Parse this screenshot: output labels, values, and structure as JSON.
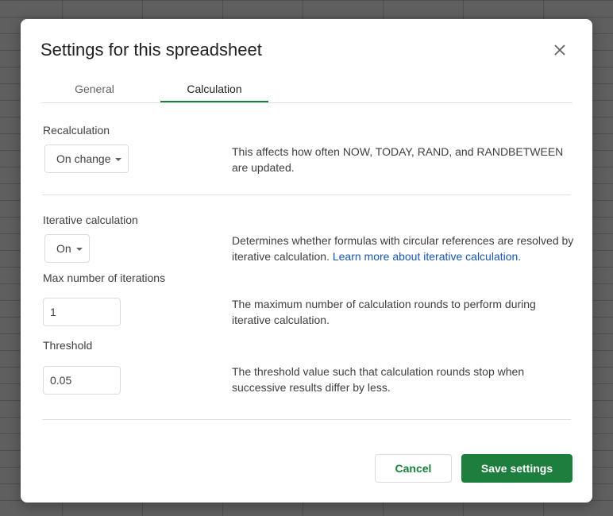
{
  "dialog": {
    "title": "Settings for this spreadsheet",
    "close_icon": "close-icon"
  },
  "tabs": [
    {
      "label": "General",
      "active": false
    },
    {
      "label": "Calculation",
      "active": true
    }
  ],
  "recalculation": {
    "label": "Recalculation",
    "value": "On change",
    "description": "This affects how often NOW, TODAY, RAND, and RANDBETWEEN are updated."
  },
  "iterative": {
    "label": "Iterative calculation",
    "value": "On",
    "description": "Determines whether formulas with circular references are resolved by iterative calculation.",
    "link_text": "Learn more about iterative calculation."
  },
  "max_iterations": {
    "label": "Max number of iterations",
    "value": "1",
    "description": "The maximum number of calculation rounds to perform during iterative calculation."
  },
  "threshold": {
    "label": "Threshold",
    "value": "0.05",
    "description": "The threshold value such that calculation rounds stop when successive results differ by less."
  },
  "buttons": {
    "cancel": "Cancel",
    "save": "Save settings"
  },
  "colors": {
    "accent": "#188038",
    "link": "#1a55b0"
  }
}
